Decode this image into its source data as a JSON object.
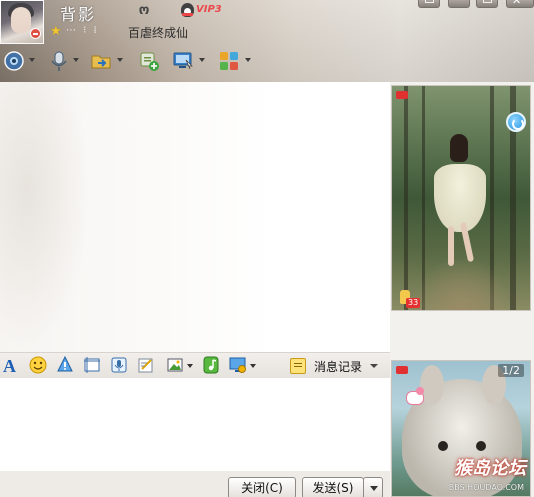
{
  "header": {
    "nickname": "背影",
    "signature": "百虐终成仙",
    "level_dots": "⋯ ⁝ ⁞",
    "vip_label": "VIP3",
    "qq_symbol": "ო"
  },
  "input_toolbar": {
    "message_record_label": "消息记录"
  },
  "show_panel": {
    "page_indicator": "1/2",
    "like_count": "33",
    "watermark_text": "猴岛论坛",
    "watermark_url": "BBS.HOUDAO.COM"
  },
  "buttons": {
    "close_label": "关闭(C)",
    "send_label": "发送(S)"
  },
  "colors": {
    "vip_red": "#e8262a",
    "accent_blue": "#1f8fdc"
  }
}
